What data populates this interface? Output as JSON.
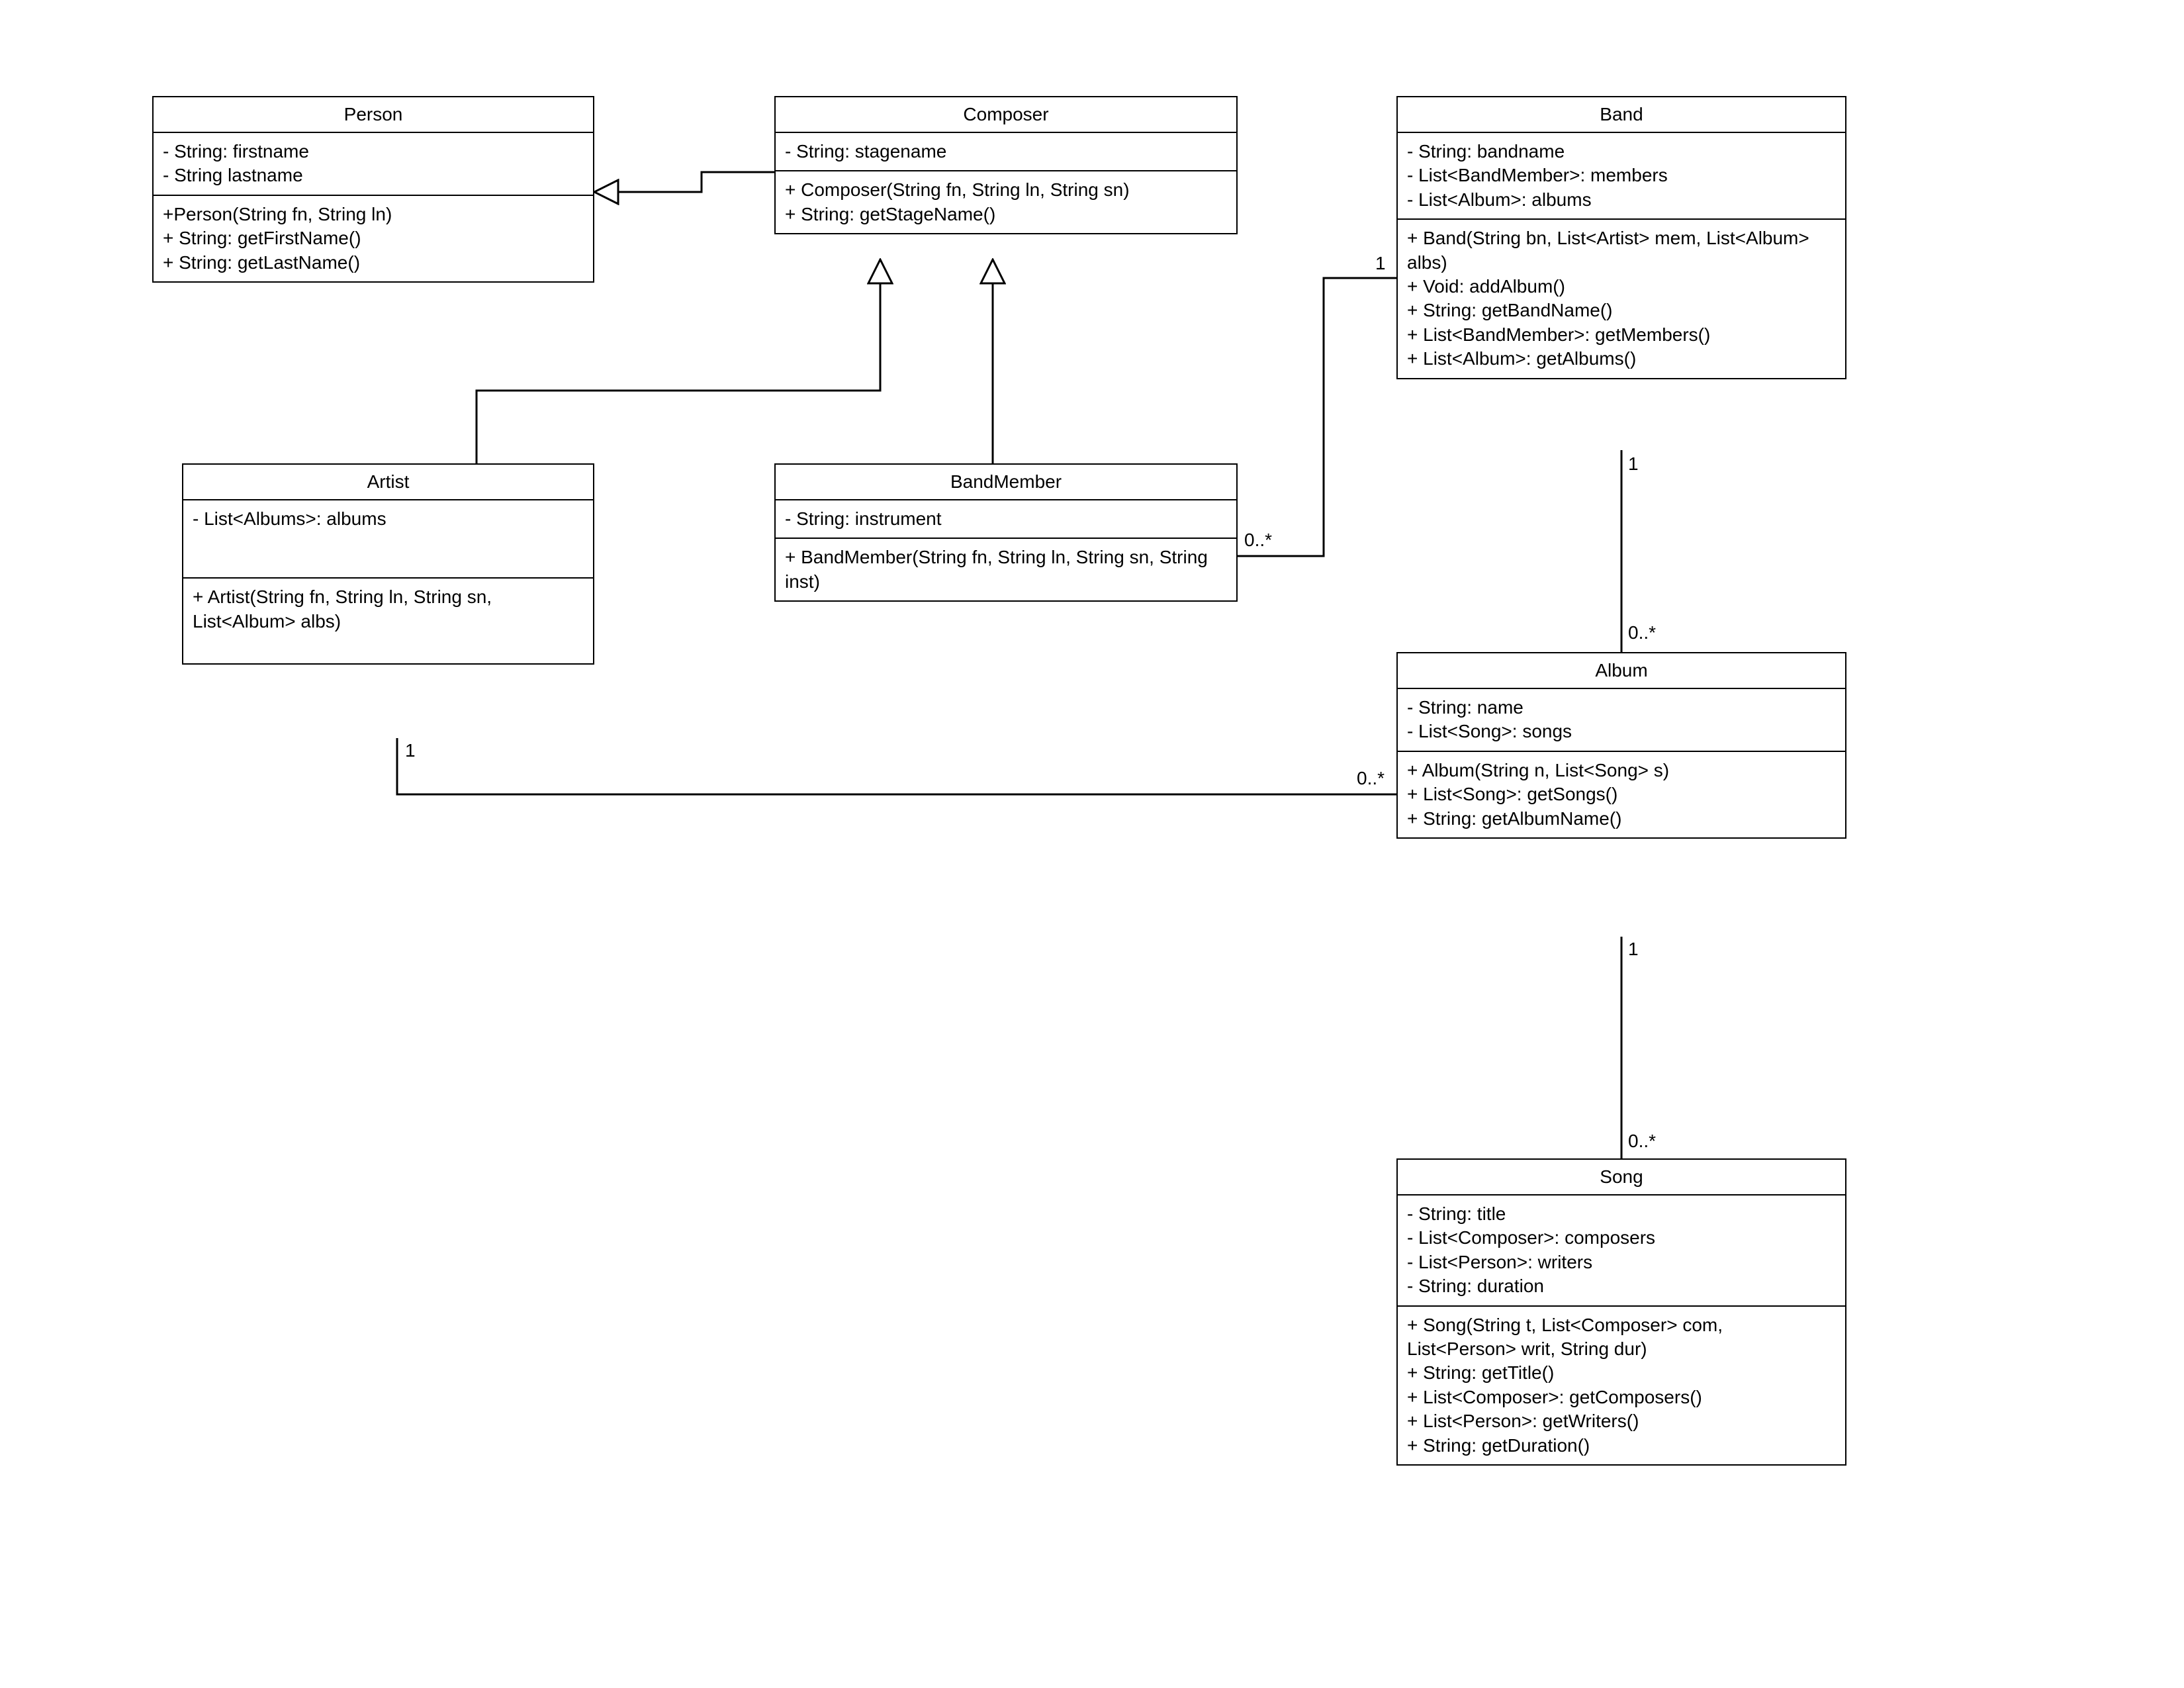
{
  "classes": {
    "person": {
      "title": "Person",
      "attrs": "- String: firstname\n- String lastname",
      "ops": "+Person(String fn, String ln)\n+ String: getFirstName()\n+ String: getLastName()"
    },
    "composer": {
      "title": "Composer",
      "attrs": "- String: stagename",
      "ops": "+ Composer(String fn, String ln, String sn)\n+ String: getStageName()"
    },
    "band": {
      "title": "Band",
      "attrs": "- String: bandname\n- List<BandMember>: members\n- List<Album>: albums",
      "ops": "+ Band(String bn, List<Artist> mem, List<Album> albs)\n+ Void: addAlbum()\n+ String: getBandName()\n+ List<BandMember>: getMembers()\n+ List<Album>: getAlbums()"
    },
    "artist": {
      "title": "Artist",
      "attrs": "- List<Albums>: albums",
      "ops": "+ Artist(String fn, String ln, String sn, List<Album> albs)"
    },
    "bandmember": {
      "title": "BandMember",
      "attrs": "- String: instrument",
      "ops": "+ BandMember(String fn, String ln, String sn, String inst)"
    },
    "album": {
      "title": "Album",
      "attrs": "- String: name\n- List<Song>: songs",
      "ops": "+ Album(String n, List<Song> s)\n+ List<Song>: getSongs()\n+ String: getAlbumName()"
    },
    "song": {
      "title": "Song",
      "attrs": "- String: title\n- List<Composer>: composers\n- List<Person>: writers\n- String: duration",
      "ops": "+ Song(String t, List<Composer> com, List<Person> writ, String dur)\n+ String: getTitle()\n+ List<Composer>: getComposers()\n+ List<Person>: getWriters()\n+ String: getDuration()"
    }
  },
  "mult": {
    "band_to_bandmember_one": "1",
    "band_to_bandmember_many": "0..*",
    "band_to_album_one": "1",
    "band_to_album_many": "0..*",
    "artist_to_album_one": "1",
    "artist_to_album_many": "0..*",
    "album_to_song_one": "1",
    "album_to_song_many": "0..*"
  }
}
